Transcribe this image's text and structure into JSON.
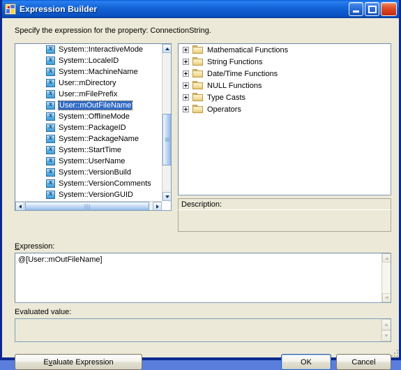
{
  "window": {
    "title": "Expression Builder",
    "icon": "expression-builder-icon",
    "titlebar_color": "#1464d8",
    "dialog_background": "#ece9d8",
    "buttons": {
      "minimize": "minimize-icon",
      "maximize": "maximize-icon",
      "close": "close-icon"
    }
  },
  "prompt": "Specify the expression for the property: ConnectionString.",
  "variables": {
    "selected": "User::mOutFileName",
    "selection_color": "#316ac5",
    "items": [
      {
        "label": "System::InteractiveMode",
        "selected": false
      },
      {
        "label": "System::LocaleID",
        "selected": false
      },
      {
        "label": "System::MachineName",
        "selected": false
      },
      {
        "label": "User::mDirectory",
        "selected": false
      },
      {
        "label": "User::mFilePrefix",
        "selected": false
      },
      {
        "label": "User::mOutFileName",
        "selected": true
      },
      {
        "label": "System::OfflineMode",
        "selected": false
      },
      {
        "label": "System::PackageID",
        "selected": false
      },
      {
        "label": "System::PackageName",
        "selected": false
      },
      {
        "label": "System::StartTime",
        "selected": false
      },
      {
        "label": "System::UserName",
        "selected": false
      },
      {
        "label": "System::VersionBuild",
        "selected": false
      },
      {
        "label": "System::VersionComments",
        "selected": false
      },
      {
        "label": "System::VersionGUID",
        "selected": false
      }
    ]
  },
  "functions_tree": {
    "nodes": [
      {
        "label": "Mathematical Functions",
        "expander": "plus"
      },
      {
        "label": "String Functions",
        "expander": "plus"
      },
      {
        "label": "Date/Time Functions",
        "expander": "plus"
      },
      {
        "label": "NULL Functions",
        "expander": "plus"
      },
      {
        "label": "Type Casts",
        "expander": "plus"
      },
      {
        "label": "Operators",
        "expander": "plus"
      }
    ]
  },
  "description": {
    "header": "Description:",
    "text": ""
  },
  "expression": {
    "label": "Expression:",
    "access_key": "E",
    "value": "@[User::mOutFileName]"
  },
  "evaluated_value": {
    "label": "Evaluated value:",
    "value": ""
  },
  "actions": {
    "evaluate_prefix": "E",
    "evaluate_key": "v",
    "evaluate_suffix": "aluate Expression",
    "evaluate": "Evaluate Expression",
    "ok": "OK",
    "cancel": "Cancel"
  }
}
